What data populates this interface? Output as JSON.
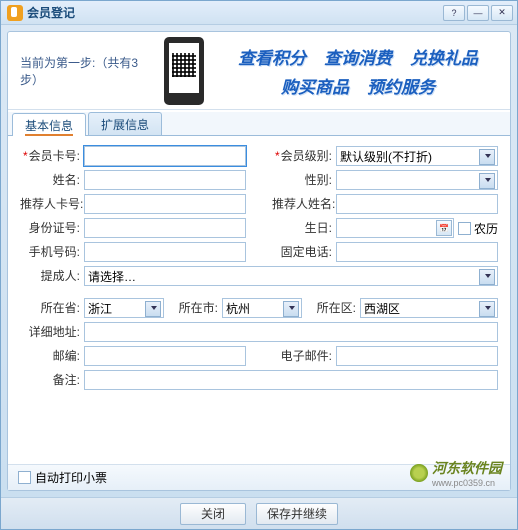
{
  "window": {
    "title": "会员登记"
  },
  "banner": {
    "step_text": "当前为第一步:（共有3步）",
    "links": [
      "查看积分",
      "查询消费",
      "兑换礼品",
      "购买商品",
      "预约服务"
    ]
  },
  "tabs": {
    "basic": "基本信息",
    "ext": "扩展信息"
  },
  "labels": {
    "card_no": "会员卡号:",
    "level": "会员级别:",
    "name": "姓名:",
    "gender": "性别:",
    "ref_card": "推荐人卡号:",
    "ref_name": "推荐人姓名:",
    "id_no": "身份证号:",
    "birthday": "生日:",
    "lunar": "农历",
    "mobile": "手机号码:",
    "phone": "固定电话:",
    "handler": "提成人:",
    "province": "所在省:",
    "city": "所在市:",
    "district": "所在区:",
    "address": "详细地址:",
    "zip": "邮编:",
    "email": "电子邮件:",
    "note": "备注:"
  },
  "values": {
    "card_no": "",
    "level": "默认级别(不打折)",
    "name": "",
    "gender": "",
    "ref_card": "",
    "ref_name": "",
    "id_no": "",
    "birthday": "",
    "mobile": "",
    "phone": "",
    "handler": "请选择…",
    "province": "浙江",
    "city": "杭州",
    "district": "西湖区",
    "address": "",
    "zip": "",
    "email": "",
    "note": ""
  },
  "footer": {
    "auto_print": "自动打印小票"
  },
  "buttons": {
    "close": "关闭",
    "save_continue": "保存并继续"
  },
  "watermark": {
    "name": "河东软件园",
    "url": "www.pc0359.cn"
  }
}
